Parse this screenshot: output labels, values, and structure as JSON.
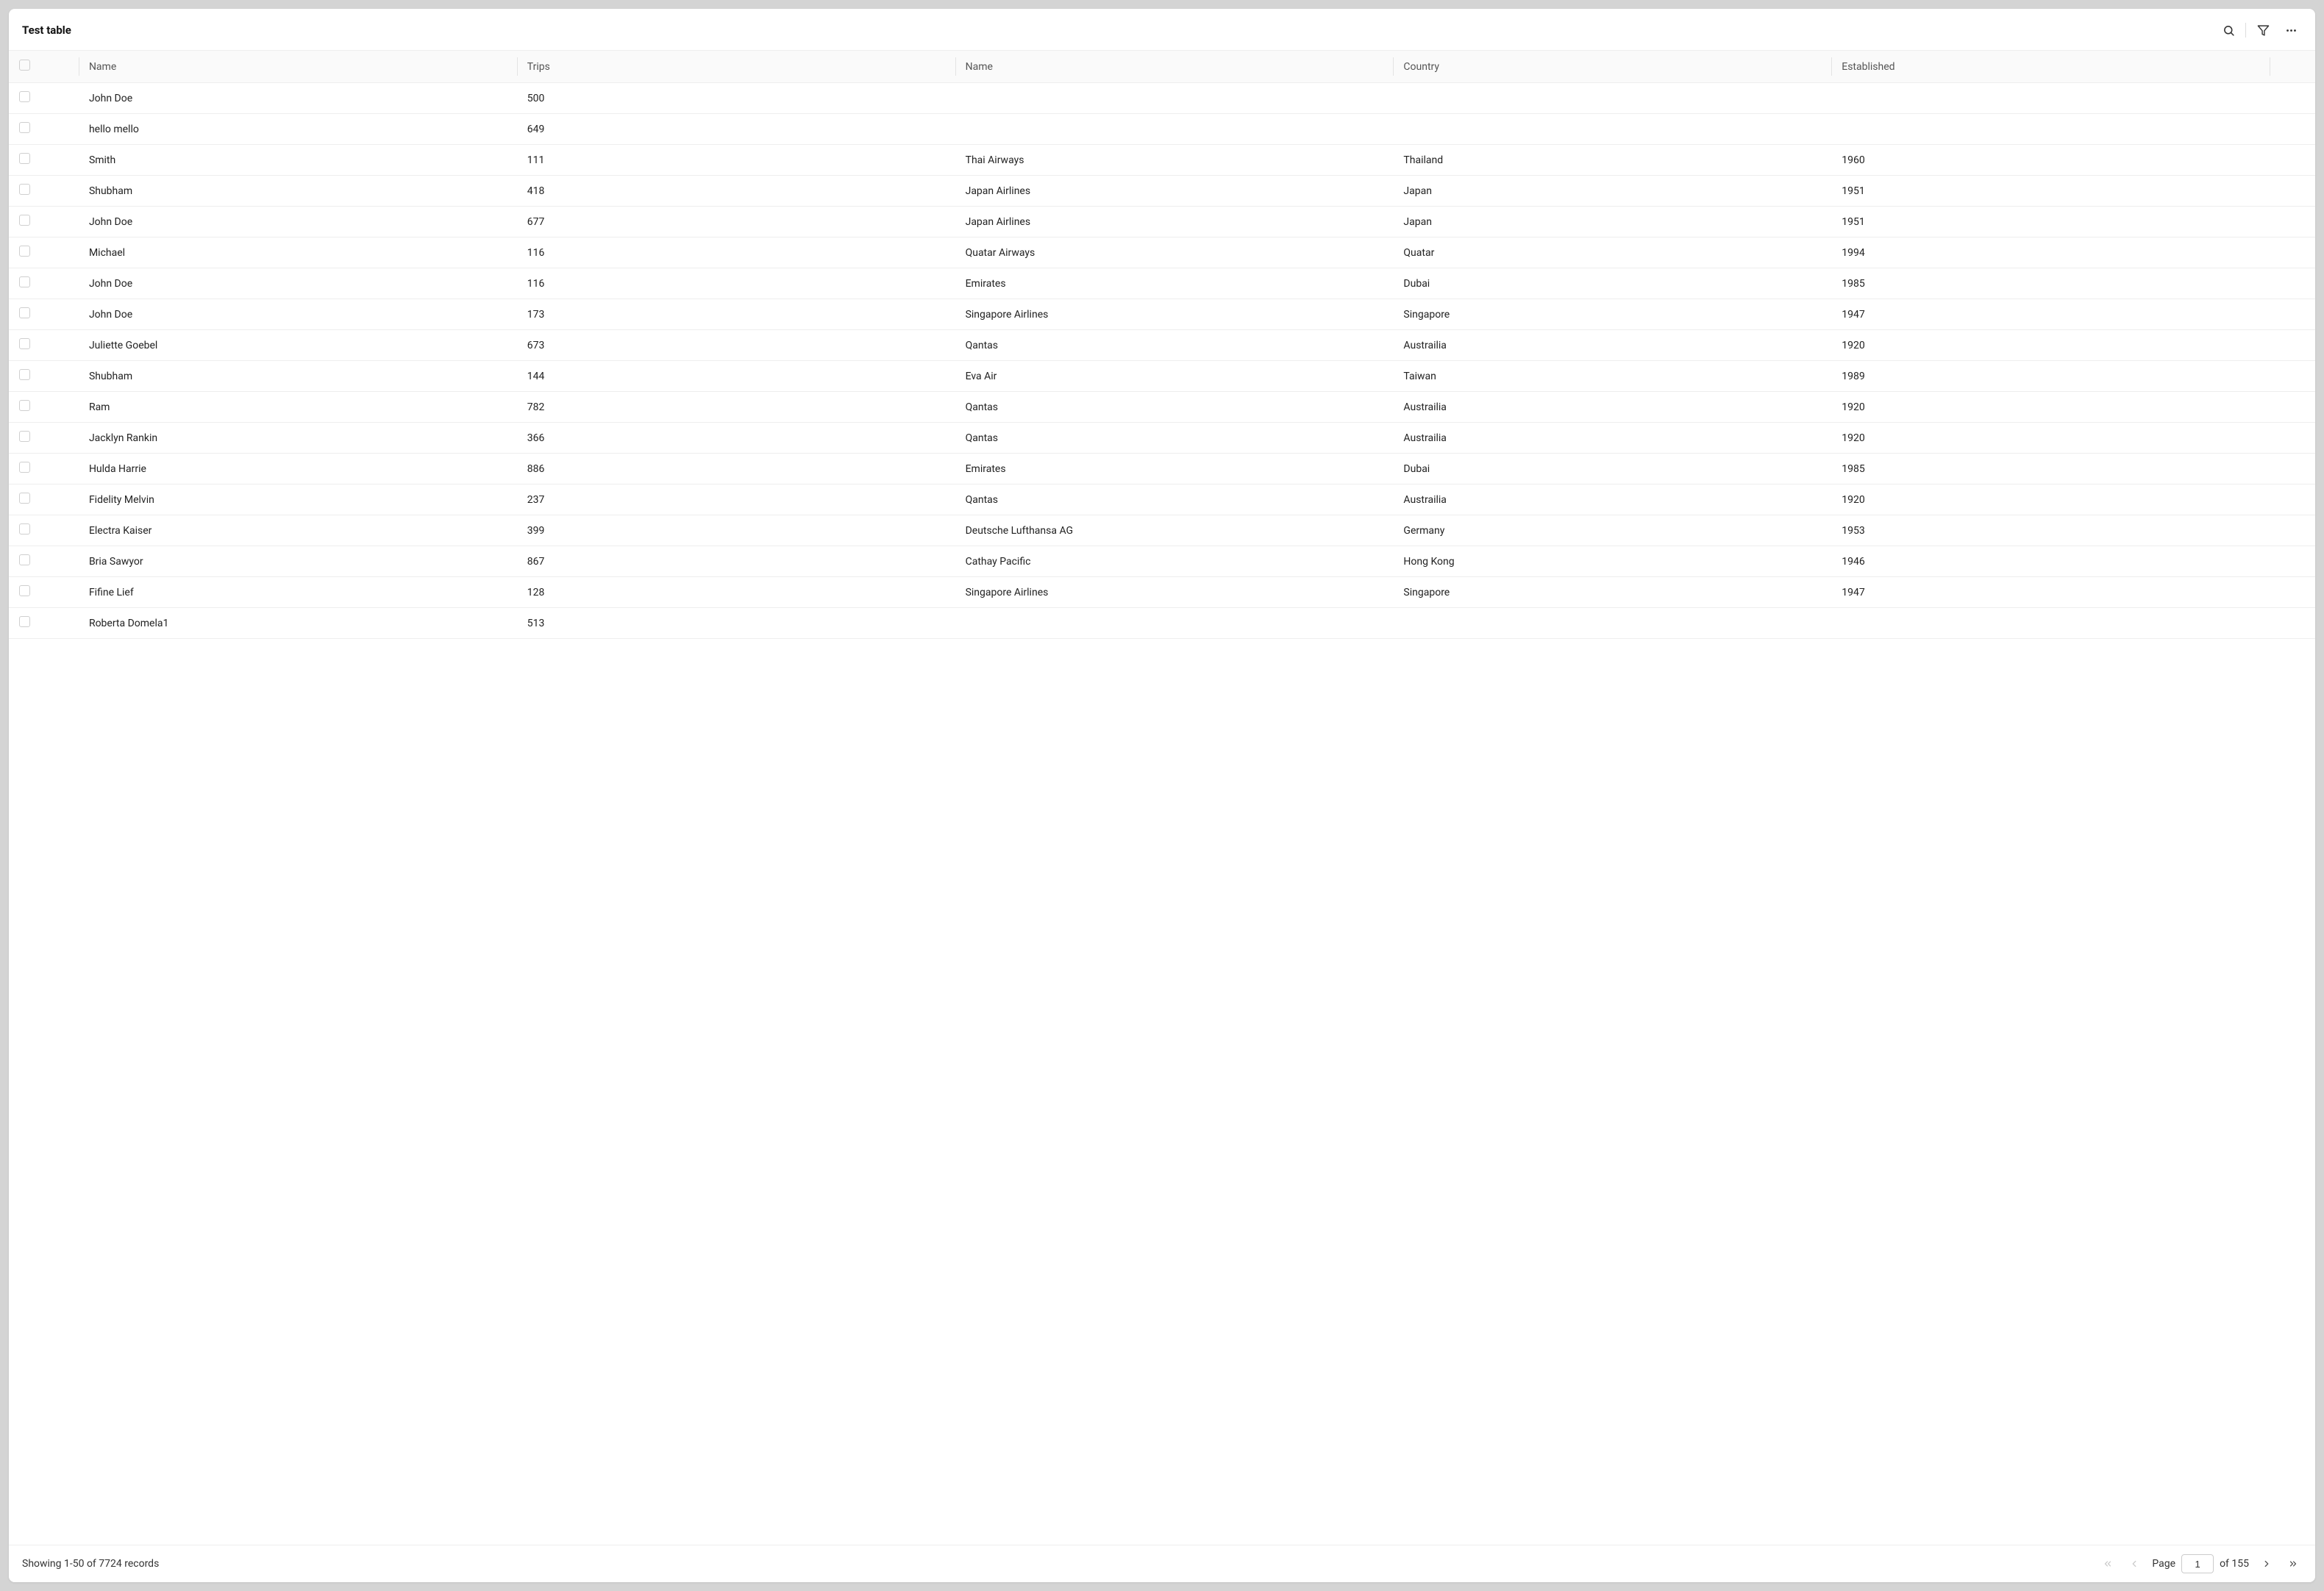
{
  "title": "Test table",
  "columns": {
    "name1": "Name",
    "trips": "Trips",
    "name2": "Name",
    "country": "Country",
    "established": "Established"
  },
  "rows": [
    {
      "name1": "John Doe",
      "trips": "500",
      "name2": "",
      "country": "",
      "established": ""
    },
    {
      "name1": "hello mello",
      "trips": "649",
      "name2": "",
      "country": "",
      "established": ""
    },
    {
      "name1": "Smith",
      "trips": "111",
      "name2": "Thai Airways",
      "country": "Thailand",
      "established": "1960"
    },
    {
      "name1": "Shubham",
      "trips": "418",
      "name2": "Japan Airlines",
      "country": "Japan",
      "established": "1951"
    },
    {
      "name1": "John Doe",
      "trips": "677",
      "name2": "Japan Airlines",
      "country": "Japan",
      "established": "1951"
    },
    {
      "name1": "Michael",
      "trips": "116",
      "name2": "Quatar Airways",
      "country": "Quatar",
      "established": "1994"
    },
    {
      "name1": "John Doe",
      "trips": "116",
      "name2": "Emirates",
      "country": "Dubai",
      "established": "1985"
    },
    {
      "name1": "John Doe",
      "trips": "173",
      "name2": "Singapore Airlines",
      "country": "Singapore",
      "established": "1947"
    },
    {
      "name1": "Juliette Goebel",
      "trips": "673",
      "name2": "Qantas",
      "country": "Austrailia",
      "established": "1920"
    },
    {
      "name1": "Shubham",
      "trips": "144",
      "name2": "Eva Air",
      "country": "Taiwan",
      "established": "1989"
    },
    {
      "name1": "Ram",
      "trips": "782",
      "name2": "Qantas",
      "country": "Austrailia",
      "established": "1920"
    },
    {
      "name1": "Jacklyn Rankin",
      "trips": "366",
      "name2": "Qantas",
      "country": "Austrailia",
      "established": "1920"
    },
    {
      "name1": "Hulda Harrie",
      "trips": "886",
      "name2": "Emirates",
      "country": "Dubai",
      "established": "1985"
    },
    {
      "name1": "Fidelity Melvin",
      "trips": "237",
      "name2": "Qantas",
      "country": "Austrailia",
      "established": "1920"
    },
    {
      "name1": "Electra Kaiser",
      "trips": "399",
      "name2": "Deutsche Lufthansa AG",
      "country": "Germany",
      "established": "1953"
    },
    {
      "name1": "Bria Sawyor",
      "trips": "867",
      "name2": "Cathay Pacific",
      "country": "Hong Kong",
      "established": "1946"
    },
    {
      "name1": "Fifine Lief",
      "trips": "128",
      "name2": "Singapore Airlines",
      "country": "Singapore",
      "established": "1947"
    },
    {
      "name1": "Roberta Domela1",
      "trips": "513",
      "name2": "",
      "country": "",
      "established": ""
    }
  ],
  "footer": {
    "status": "Showing 1-50 of 7724 records",
    "page_label": "Page",
    "page_value": "1",
    "of_label": "of 155"
  }
}
